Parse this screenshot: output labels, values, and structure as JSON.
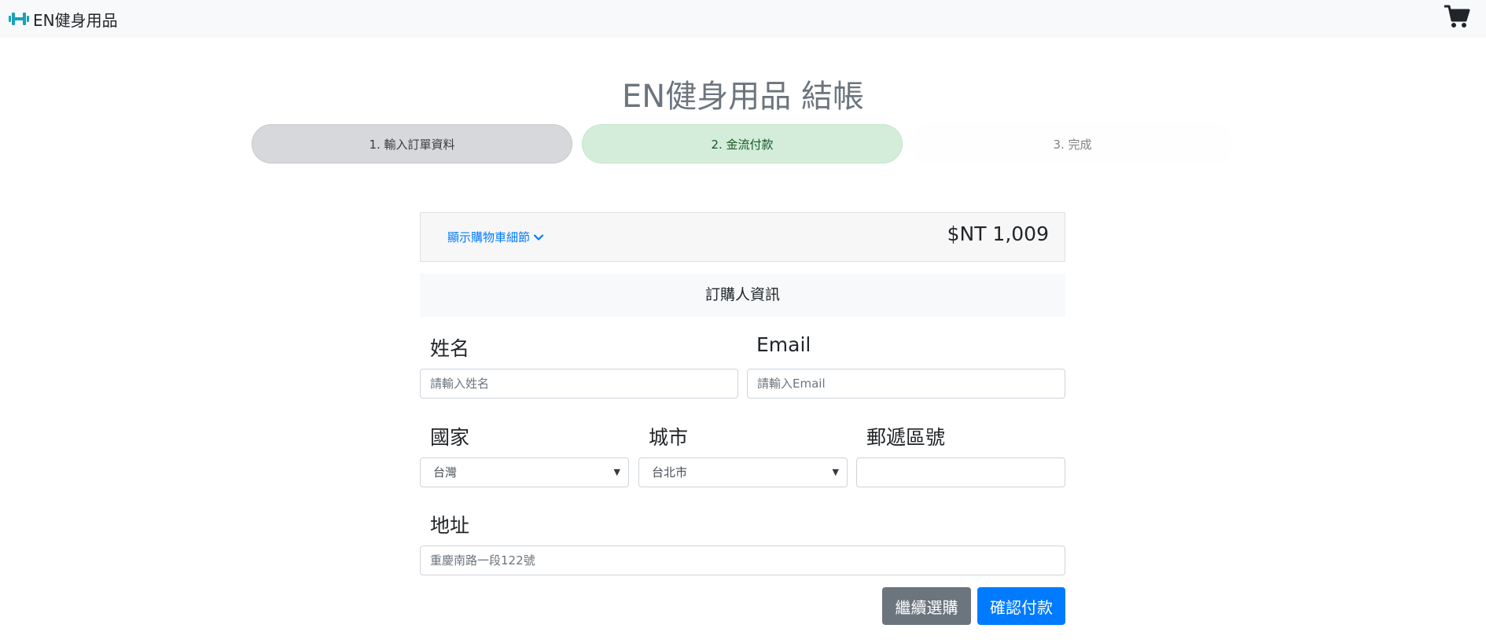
{
  "navbar": {
    "brand": "EN健身用品"
  },
  "page": {
    "title": "EN健身用品 結帳"
  },
  "steps": [
    {
      "label": "1. 輸入訂單資料",
      "state": "done"
    },
    {
      "label": "2. 金流付款",
      "state": "active"
    },
    {
      "label": "3. 完成",
      "state": "pending"
    }
  ],
  "cart_summary": {
    "toggle_label": "顯示購物車細節",
    "total": "$NT 1,009"
  },
  "form": {
    "section_title": "訂購人資訊",
    "name": {
      "label": "姓名",
      "placeholder": "請輸入姓名",
      "value": ""
    },
    "email": {
      "label": "Email",
      "placeholder": "請輸入Email",
      "value": ""
    },
    "country": {
      "label": "國家",
      "selected": "台灣"
    },
    "city": {
      "label": "城市",
      "selected": "台北市"
    },
    "postal": {
      "label": "郵遞區號",
      "value": ""
    },
    "address": {
      "label": "地址",
      "placeholder": "重慶南路一段122號",
      "value": ""
    }
  },
  "actions": {
    "continue_label": "繼續選購",
    "confirm_label": "確認付款"
  },
  "colors": {
    "brand_icon": "#17a2b8",
    "primary": "#007bff",
    "secondary": "#6c757d",
    "step_active_bg": "#d4edda"
  }
}
